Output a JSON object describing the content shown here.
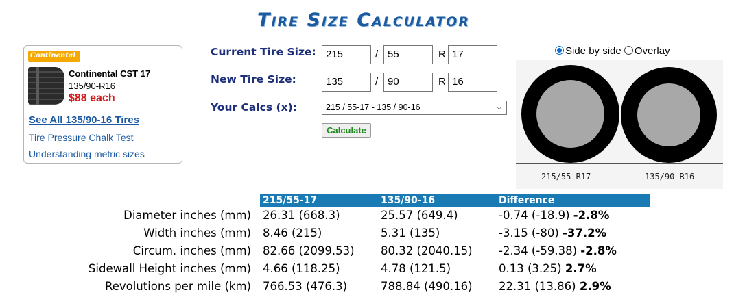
{
  "page_title": "Tire Size Calculator",
  "ad": {
    "brand": "Continental",
    "model": "Continental CST 17",
    "size": "135/90-R16",
    "price": "$88 each",
    "see_all_link": "See All 135/90-16 Tires",
    "links": [
      "Tire Pressure Chalk Test",
      "Understanding metric sizes"
    ]
  },
  "form": {
    "current_label": "Current Tire Size:",
    "new_label": "New Tire Size:",
    "calcs_label": "Your Calcs (x):",
    "current": {
      "width": "215",
      "aspect": "55",
      "rim": "17"
    },
    "new": {
      "width": "135",
      "aspect": "90",
      "rim": "16"
    },
    "slash": "/",
    "r": "R",
    "calcs_selected": "215 / 55-17 - 135 / 90-16",
    "calculate_button": "Calculate"
  },
  "visual": {
    "options": [
      "Side by side",
      "Overlay"
    ],
    "selected_option": "Side by side",
    "tire_labels": [
      "215/55-R17",
      "135/90-R16"
    ],
    "colors": {
      "tire": "#000000",
      "rim": "#a8a8a8"
    }
  },
  "results": {
    "headers": [
      "215/55-17",
      "135/90-16",
      "Difference"
    ],
    "rows": [
      {
        "label": "Diameter inches (mm)",
        "current": "26.31 (668.3)",
        "new": "25.57 (649.4)",
        "diff": "-0.74 (-18.9)",
        "pct": "-2.8%"
      },
      {
        "label": "Width inches (mm)",
        "current": "8.46 (215)",
        "new": "5.31 (135)",
        "diff": "-3.15 (-80)",
        "pct": "-37.2%"
      },
      {
        "label": "Circum. inches (mm)",
        "current": "82.66 (2099.53)",
        "new": "80.32 (2040.15)",
        "diff": "-2.34 (-59.38)",
        "pct": "-2.8%"
      },
      {
        "label": "Sidewall Height inches (mm)",
        "current": "4.66 (118.25)",
        "new": "4.78 (121.5)",
        "diff": "0.13 (3.25)",
        "pct": "2.7%"
      },
      {
        "label": "Revolutions per mile (km)",
        "current": "766.53 (476.3)",
        "new": "788.84 (490.16)",
        "diff": "22.31 (13.86)",
        "pct": "2.9%"
      }
    ],
    "header_color": "#1a7ab3"
  }
}
